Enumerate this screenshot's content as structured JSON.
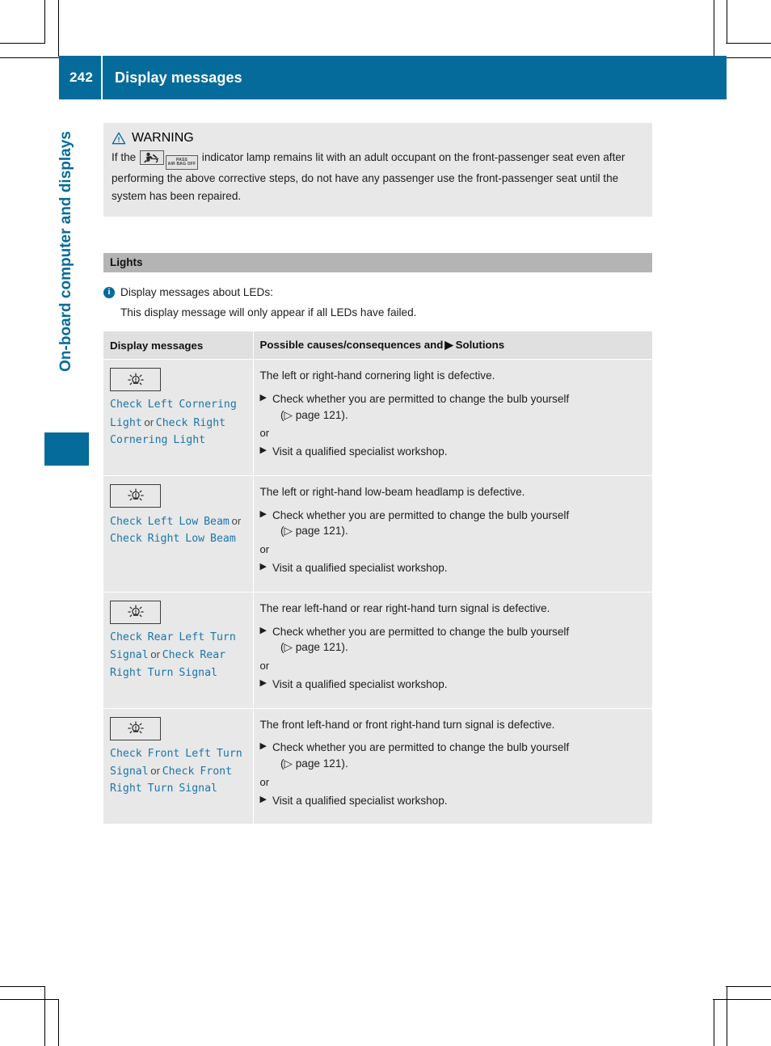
{
  "header": {
    "page_number": "242",
    "title": "Display messages"
  },
  "sidebar": {
    "chapter_label": "On-board computer and displays"
  },
  "warning": {
    "label": "WARNING",
    "text_before_icons": "If the",
    "icon1_name": "airbag-off-icon",
    "icon2_line1": "PASS",
    "icon2_line2": "AIR BAG OFF",
    "text_after_icons": "indicator lamp remains lit with an adult occupant on the front-passenger seat even after performing the above corrective steps, do not have any passenger use the front-passenger seat until the system has been repaired."
  },
  "section": {
    "title": "Lights"
  },
  "note": {
    "line1": "Display messages about LEDs:",
    "line2": "This display message will only appear if all LEDs have failed."
  },
  "table": {
    "header_left": "Display messages",
    "header_right_part1": "Possible causes/consequences and",
    "header_right_arrow": "▶",
    "header_right_part2": "Solutions",
    "rows": [
      {
        "icon": "bulb-warning-icon",
        "message_parts": [
          {
            "type": "msg",
            "text": "Check Left Cornering Light"
          },
          {
            "type": "sep",
            "text": " or "
          },
          {
            "type": "msg",
            "text": "Check Right Cornering Light"
          }
        ],
        "cause": "The left or right-hand cornering light is defective.",
        "solution1": "Check whether you are permitted to change the bulb yourself",
        "solution1_ref": "(▷ page 121).",
        "or_label": "or",
        "solution2": "Visit a qualified specialist workshop."
      },
      {
        "icon": "bulb-warning-icon",
        "message_parts": [
          {
            "type": "msg",
            "text": "Check Left Low Beam"
          },
          {
            "type": "sep",
            "text": " or "
          },
          {
            "type": "msg",
            "text": "Check Right Low Beam"
          }
        ],
        "cause": "The left or right-hand low-beam headlamp is defective.",
        "solution1": "Check whether you are permitted to change the bulb yourself",
        "solution1_ref": "(▷ page 121).",
        "or_label": "or",
        "solution2": "Visit a qualified specialist workshop."
      },
      {
        "icon": "bulb-warning-icon",
        "message_parts": [
          {
            "type": "msg",
            "text": "Check Rear Left Turn Signal"
          },
          {
            "type": "sep",
            "text": " or "
          },
          {
            "type": "msg",
            "text": "Check Rear Right Turn Signal"
          }
        ],
        "cause": "The rear left-hand or rear right-hand turn signal is defective.",
        "solution1": "Check whether you are permitted to change the bulb yourself",
        "solution1_ref": "(▷ page 121).",
        "or_label": "or",
        "solution2": "Visit a qualified specialist workshop."
      },
      {
        "icon": "bulb-warning-icon",
        "message_parts": [
          {
            "type": "msg",
            "text": "Check Front Left Turn Signal"
          },
          {
            "type": "sep",
            "text": " or "
          },
          {
            "type": "msg",
            "text": "Check Front Right Turn Signal"
          }
        ],
        "cause": "The front left-hand or front right-hand turn signal is defective.",
        "solution1": "Check whether you are permitted to change the bulb yourself",
        "solution1_ref": "(▷ page 121).",
        "or_label": "or",
        "solution2": "Visit a qualified specialist workshop."
      }
    ]
  },
  "colors": {
    "brand_blue": "#046b9b",
    "message_blue": "#1b76a8",
    "section_gray": "#b4b4b4",
    "table_gray": "#e8e8e8",
    "table_header_gray": "#e0e0e0"
  }
}
